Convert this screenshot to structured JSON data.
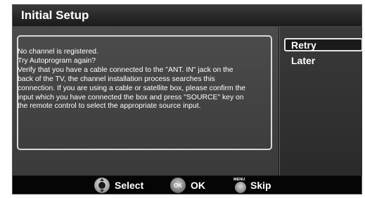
{
  "dialog": {
    "title": "Initial Setup",
    "message_lines": [
      "No channel is registered.",
      "Try Autoprogram again?",
      "Verify that you have a cable connected to the \"ANT. IN\" jack on the",
      "back of the TV, the channel installation process searches this",
      "connection. If you are using a cable or satellite box, please confirm the",
      "input which you have connected the box and press \"SOURCE\" key on",
      "the remote control to select the appropriate source input."
    ]
  },
  "options": {
    "selected_index": 0,
    "items": [
      {
        "label": "Retry"
      },
      {
        "label": "Later"
      }
    ]
  },
  "footer": {
    "select_label": "Select",
    "ok_icon_text": "OK",
    "ok_label": "OK",
    "menu_icon_text": "MENU",
    "skip_label": "Skip"
  },
  "colors": {
    "highlight_border": "#e6e6e6",
    "text": "#ffffff",
    "background": "#111111"
  },
  "icons": [
    "dpad-icon",
    "ok-button-icon",
    "menu-button-icon"
  ]
}
